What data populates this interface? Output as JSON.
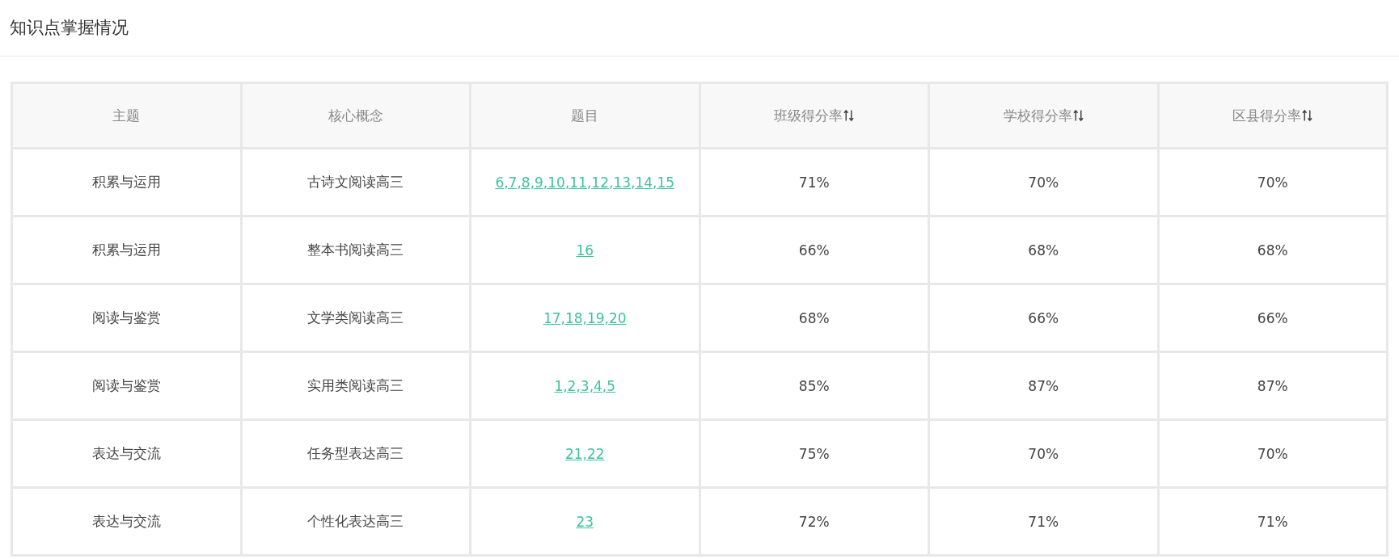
{
  "title": "知识点掌握情况",
  "table": {
    "columns": [
      {
        "label": "主题",
        "sortable": false
      },
      {
        "label": "核心概念",
        "sortable": false
      },
      {
        "label": "题目",
        "sortable": false
      },
      {
        "label": "班级得分率",
        "sortable": true
      },
      {
        "label": "学校得分率",
        "sortable": true
      },
      {
        "label": "区县得分率",
        "sortable": true
      }
    ],
    "rows": [
      {
        "theme": "积累与运用",
        "concept": "古诗文阅读高三",
        "questions": "6,7,8,9,10,11,12,13,14,15",
        "class_rate": "71%",
        "school_rate": "70%",
        "district_rate": "70%"
      },
      {
        "theme": "积累与运用",
        "concept": "整本书阅读高三",
        "questions": "16",
        "class_rate": "66%",
        "school_rate": "68%",
        "district_rate": "68%"
      },
      {
        "theme": "阅读与鉴赏",
        "concept": "文学类阅读高三",
        "questions": "17,18,19,20",
        "class_rate": "68%",
        "school_rate": "66%",
        "district_rate": "66%"
      },
      {
        "theme": "阅读与鉴赏",
        "concept": "实用类阅读高三",
        "questions": "1,2,3,4,5",
        "class_rate": "85%",
        "school_rate": "87%",
        "district_rate": "87%"
      },
      {
        "theme": "表达与交流",
        "concept": "任务型表达高三",
        "questions": "21,22",
        "class_rate": "75%",
        "school_rate": "70%",
        "district_rate": "70%"
      },
      {
        "theme": "表达与交流",
        "concept": "个性化表达高三",
        "questions": "23",
        "class_rate": "72%",
        "school_rate": "71%",
        "district_rate": "71%"
      }
    ]
  }
}
